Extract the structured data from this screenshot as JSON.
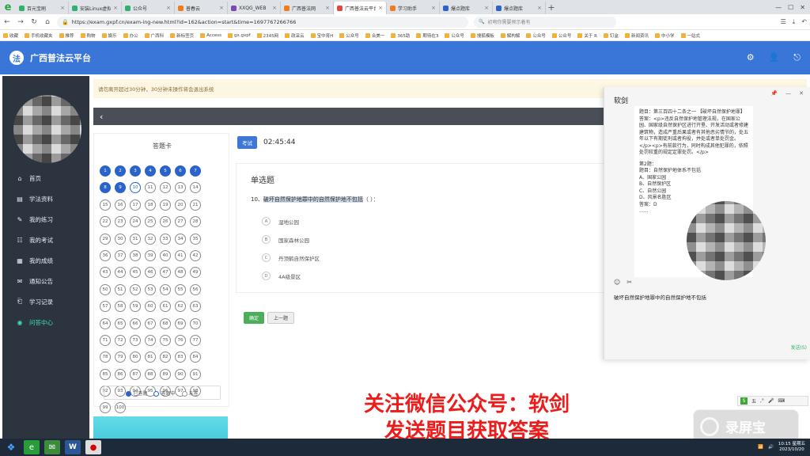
{
  "browser": {
    "tabs": [
      {
        "label": "百元宝刷",
        "color": "#2db36b"
      },
      {
        "label": "安装Linux虚拟",
        "color": "#2db36b"
      },
      {
        "label": "公众号",
        "color": "#2db36b"
      },
      {
        "label": "普春云",
        "color": "#f07c1c"
      },
      {
        "label": "XXQG_WEB",
        "color": "#7a4ab0"
      },
      {
        "label": "广西普法网",
        "color": "#f07c1c"
      },
      {
        "label": "广西普法云平台",
        "color": "#e04a3c"
      },
      {
        "label": "学习助手",
        "color": "#f07c1c"
      },
      {
        "label": "爆点题库",
        "color": "#2a63c9"
      },
      {
        "label": "爆点题库",
        "color": "#2a63c9"
      }
    ],
    "url": "https://exam.gxpf.cn/exam-ing-new.html?id=162&action=start&time=1697767266766",
    "search_text": "初吻你需要预示着有",
    "bookmarks": [
      "收藏",
      "手机收藏夹",
      "推荐",
      "购物",
      "娱乐",
      "办公",
      "广西科",
      "新标签页",
      "Access",
      "gx.gxpf",
      "2345网",
      "政采云",
      "宝中育H",
      "公众号",
      "合美一",
      "365助",
      "期待在3",
      "公众号",
      "搜狐模板",
      "解构解",
      "公众号",
      "公众号",
      "关于 R",
      "钉盒",
      "新闻资讯",
      "中小学",
      "一站式"
    ]
  },
  "app": {
    "title": "广西普法云平台",
    "logo_char": "法"
  },
  "sidebar": {
    "items": [
      {
        "label": "首页",
        "icon": "⌂"
      },
      {
        "label": "学法资料",
        "icon": "▤"
      },
      {
        "label": "我的练习",
        "icon": "✎"
      },
      {
        "label": "我的考试",
        "icon": "☷"
      },
      {
        "label": "我的成绩",
        "icon": "▦"
      },
      {
        "label": "通知公告",
        "icon": "✉"
      },
      {
        "label": "学习记录",
        "icon": "⎗"
      },
      {
        "label": "问答中心",
        "icon": "◉"
      }
    ]
  },
  "notice": "请勿离开超过30分钟，30分钟未操作将会退出系统",
  "answer_card": {
    "title": "答题卡",
    "answered_count": 9,
    "current": 10,
    "total": 100,
    "legend": {
      "answered": "已答题",
      "current": "答题中",
      "unanswered": "未答"
    },
    "answered_box": "已答题"
  },
  "exam": {
    "badge": "考试",
    "timer": "02:45:44",
    "question_type": "单选题",
    "question_number": "10、",
    "question_highlight": "破坏自然保护地罪中的自然保护地不包括",
    "question_tail": "（  ）：",
    "options": [
      {
        "letter": "A",
        "text": "湿地公园"
      },
      {
        "letter": "B",
        "text": "国家森林公园"
      },
      {
        "letter": "C",
        "text": "丹顶鹤自然保护区"
      },
      {
        "letter": "D",
        "text": "4A级景区"
      }
    ],
    "confirm_label": "确定",
    "prev_label": "上一题"
  },
  "chat": {
    "title": "软剑",
    "messages": [
      "题目：第三百四十二条之一 【破坏自然保护地罪】",
      "答案：<p>违反自然保护地管理法规，在国家公园、国家级自然保护区进行开垦、开发活动或者修建建筑物，造成严重后果或者有其他恶劣情节的，处五年以下有期徒刑或者拘役，并处或者单处罚金。</p><p>有前款行为，同时构成其他犯罪的，依照处罚较重的规定定罪处罚。</p>",
      "第2题：",
      "题目：自然保护地体系不包括",
      "A、国家公园",
      "B、自然保护区",
      "C、自然公园",
      "D、风景名胜区",
      "答案：D",
      "......"
    ],
    "input_text": "破坏自然保护地罪中的自然保护地不包括",
    "send_label": "发送(S)"
  },
  "overlay": {
    "promo_line1": "关注微信公众号：软剑",
    "promo_line2": "发送题目获取答案",
    "watermark": "录屏宝",
    "ime_label": "五"
  },
  "taskbar": {
    "time": "10:15 星期五",
    "date": "2023/10/20"
  }
}
